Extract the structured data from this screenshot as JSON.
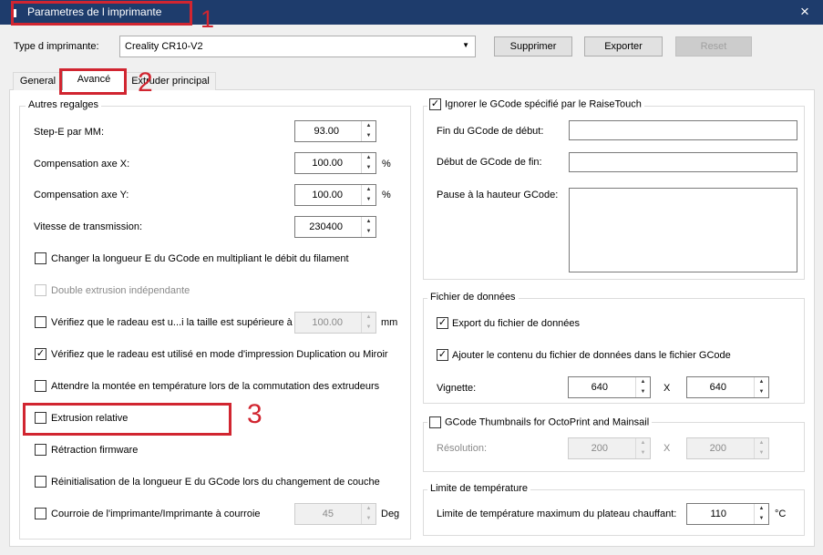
{
  "window": {
    "title": "Parametres de l imprimante",
    "close_icon": "×"
  },
  "printer": {
    "label": "Type d imprimante:",
    "selected": "Creality CR10-V2"
  },
  "buttons": {
    "delete": "Supprimer",
    "export": "Exporter",
    "reset": "Reset"
  },
  "tabs": {
    "general": "General",
    "advanced": "Avancé",
    "extruder": "Extruder principal"
  },
  "other": {
    "title": "Autres regalges",
    "step_e": {
      "label": "Step-E par MM:",
      "value": "93.00"
    },
    "comp_x": {
      "label": "Compensation axe X:",
      "value": "100.00",
      "unit": "%"
    },
    "comp_y": {
      "label": "Compensation axe Y:",
      "value": "100.00",
      "unit": "%"
    },
    "baud": {
      "label": "Vitesse de transmission:",
      "value": "230400"
    },
    "opt_length_e": "Changer la longueur E du GCode en multipliant le débit du filament",
    "opt_dual": "Double extrusion indépendante",
    "opt_raft_size": "Vérifiez que le radeau est u...i la taille est supérieure à",
    "raft_value": "100.00",
    "raft_unit": "mm",
    "opt_raft_dup": "Vérifiez que le radeau est utilisé en mode d'impression Duplication ou Miroir",
    "opt_wait_temp": "Attendre la montée en température lors de la commutation des extrudeurs",
    "opt_relative": "Extrusion relative",
    "opt_fw_retract": "Rétraction firmware",
    "opt_reset_e": "Réinitialisation de la longueur E du GCode lors du changement de couche",
    "opt_belt": "Courroie de l'imprimante/Imprimante à courroie",
    "belt_value": "45",
    "belt_unit": "Deg"
  },
  "raise": {
    "title": "Ignorer le GCode spécifié par le RaiseTouch",
    "start_end": "Fin du GCode de début:",
    "end_start": "Début de GCode de fin:",
    "pause": "Pause à la hauteur GCode:"
  },
  "datafile": {
    "title": "Fichier de données",
    "export": "Export du fichier de données",
    "append": "Ajouter le contenu du fichier de données dans le fichier GCode",
    "thumb_label": "Vignette:",
    "thumb_w": "640",
    "thumb_x": "X",
    "thumb_h": "640"
  },
  "octo": {
    "title": "GCode Thumbnails for OctoPrint and Mainsail",
    "res_label": "Résolution:",
    "w": "200",
    "x": "X",
    "h": "200"
  },
  "temp": {
    "title": "Limite de température",
    "label": "Limite de température maximum du plateau chauffant:",
    "value": "110",
    "unit": "°C"
  },
  "annotations": {
    "n1": "1",
    "n2": "2",
    "n3": "3"
  }
}
